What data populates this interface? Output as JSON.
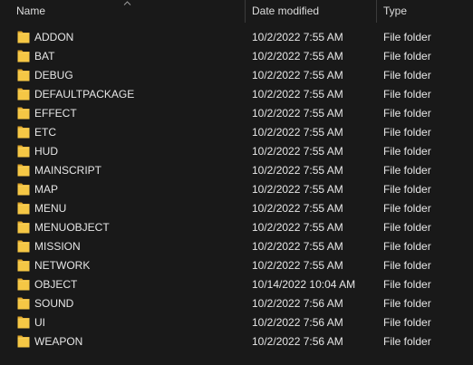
{
  "columns": {
    "name": "Name",
    "date_modified": "Date modified",
    "type": "Type"
  },
  "sort": {
    "column": "name",
    "direction": "ascending",
    "icon": "chevron-up-icon"
  },
  "folder_icon": "folder-icon",
  "colors": {
    "background": "#191919",
    "folder": "#f5c745",
    "text": "#e6e6e6"
  },
  "files": [
    {
      "name": "ADDON",
      "date": "10/2/2022 7:55 AM",
      "type": "File folder"
    },
    {
      "name": "BAT",
      "date": "10/2/2022 7:55 AM",
      "type": "File folder"
    },
    {
      "name": "DEBUG",
      "date": "10/2/2022 7:55 AM",
      "type": "File folder"
    },
    {
      "name": "DEFAULTPACKAGE",
      "date": "10/2/2022 7:55 AM",
      "type": "File folder"
    },
    {
      "name": "EFFECT",
      "date": "10/2/2022 7:55 AM",
      "type": "File folder"
    },
    {
      "name": "ETC",
      "date": "10/2/2022 7:55 AM",
      "type": "File folder"
    },
    {
      "name": "HUD",
      "date": "10/2/2022 7:55 AM",
      "type": "File folder"
    },
    {
      "name": "MAINSCRIPT",
      "date": "10/2/2022 7:55 AM",
      "type": "File folder"
    },
    {
      "name": "MAP",
      "date": "10/2/2022 7:55 AM",
      "type": "File folder"
    },
    {
      "name": "MENU",
      "date": "10/2/2022 7:55 AM",
      "type": "File folder"
    },
    {
      "name": "MENUOBJECT",
      "date": "10/2/2022 7:55 AM",
      "type": "File folder"
    },
    {
      "name": "MISSION",
      "date": "10/2/2022 7:55 AM",
      "type": "File folder"
    },
    {
      "name": "NETWORK",
      "date": "10/2/2022 7:55 AM",
      "type": "File folder"
    },
    {
      "name": "OBJECT",
      "date": "10/14/2022 10:04 AM",
      "type": "File folder"
    },
    {
      "name": "SOUND",
      "date": "10/2/2022 7:56 AM",
      "type": "File folder"
    },
    {
      "name": "UI",
      "date": "10/2/2022 7:56 AM",
      "type": "File folder"
    },
    {
      "name": "WEAPON",
      "date": "10/2/2022 7:56 AM",
      "type": "File folder"
    }
  ]
}
